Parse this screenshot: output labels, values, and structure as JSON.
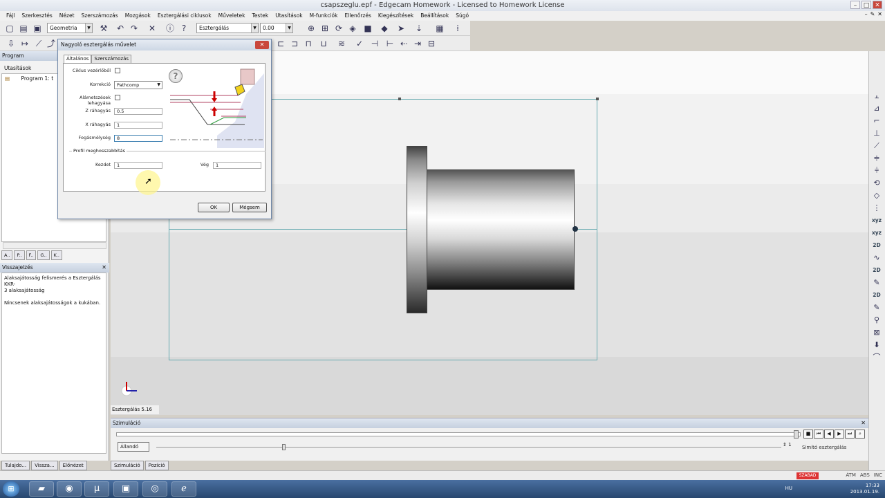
{
  "window": {
    "title": "csapszeglu.epf - Edgecam Homework - Licensed to Homework License",
    "controls": [
      "–",
      "□",
      "✕"
    ],
    "mdi_controls": [
      "–",
      "✎",
      "✕"
    ]
  },
  "menu": [
    "Fájl",
    "Szerkesztés",
    "Nézet",
    "Szerszámozás",
    "Mozgások",
    "Esztergálási ciklusok",
    "Műveletek",
    "Testek",
    "Utasítások",
    "M-funkciók",
    "Ellenőrzés",
    "Kiegészítések",
    "Beállítások",
    "Súgó"
  ],
  "toolbar": {
    "mode_combo": "Geometria",
    "operation_combo": "Esztergálás",
    "value_combo": "0.00"
  },
  "left_pane": {
    "header": "Program",
    "section_label": "Utasítások",
    "tree_items": [
      "Program 1: t"
    ],
    "tabs": [
      "A..",
      "P..",
      "F..",
      "G..",
      "K.."
    ],
    "feedback": {
      "header": "Visszajelzés",
      "lines": [
        "Alaksajátosság felismerés a Esztergálás KKR-",
        "  3 alaksajátosság",
        "",
        "Nincsenek alaksajátosságok a kukában."
      ]
    },
    "bottom_tabs": [
      "Tulajdo...",
      "Vissza...",
      "Előnézet"
    ]
  },
  "viewport": {
    "status": "Esztergálás 5.16"
  },
  "right_toolbar_text": [
    "xyz",
    "xyz",
    "2D",
    "2D",
    "2D"
  ],
  "simulation": {
    "header": "Szimuláció",
    "mode_button": "Állandó",
    "spin_value": "1",
    "current_op": "Simító esztergálás",
    "tabs": [
      "Szimuláció",
      "Pozíció"
    ]
  },
  "statusbar": {
    "badge": "SZABAD",
    "items": [
      "ÁTM",
      "ABS",
      "INC"
    ]
  },
  "taskbar": {
    "lang": "HU",
    "time": "17:33",
    "date": "2013.01.19."
  },
  "dialog": {
    "title": "Nagyoló esztergálás művelet",
    "tabs": [
      "Általános",
      "Szerszámozás"
    ],
    "fields": {
      "ciklus_label": "Ciklus vezérlőből",
      "korrekcio_label": "Korrekció",
      "korrekcio_value": "Pathcomp",
      "alametszesek_label": "Alámetszések",
      "alametszesek_label2": "lehagyása",
      "z_label": "Z ráhagyás",
      "z_value": "0.5",
      "x_label": "X ráhagyás",
      "x_value": "1",
      "fogas_label": "Fogásmélység",
      "fogas_value": "8",
      "group_label": "Profil meghosszabbítás",
      "kezdet_label": "Kezdet",
      "kezdet_value": "1",
      "veg_label": "Vég",
      "veg_value": "1"
    },
    "ok_label": "OK",
    "cancel_label": "Mégsem"
  },
  "colors": {
    "accent": "#66aab0",
    "close": "#c9473c",
    "badge": "#dd3333",
    "tool_insert": "#f2d21c",
    "arrow_red": "#cc0000",
    "pass_lines": "#b04060"
  }
}
